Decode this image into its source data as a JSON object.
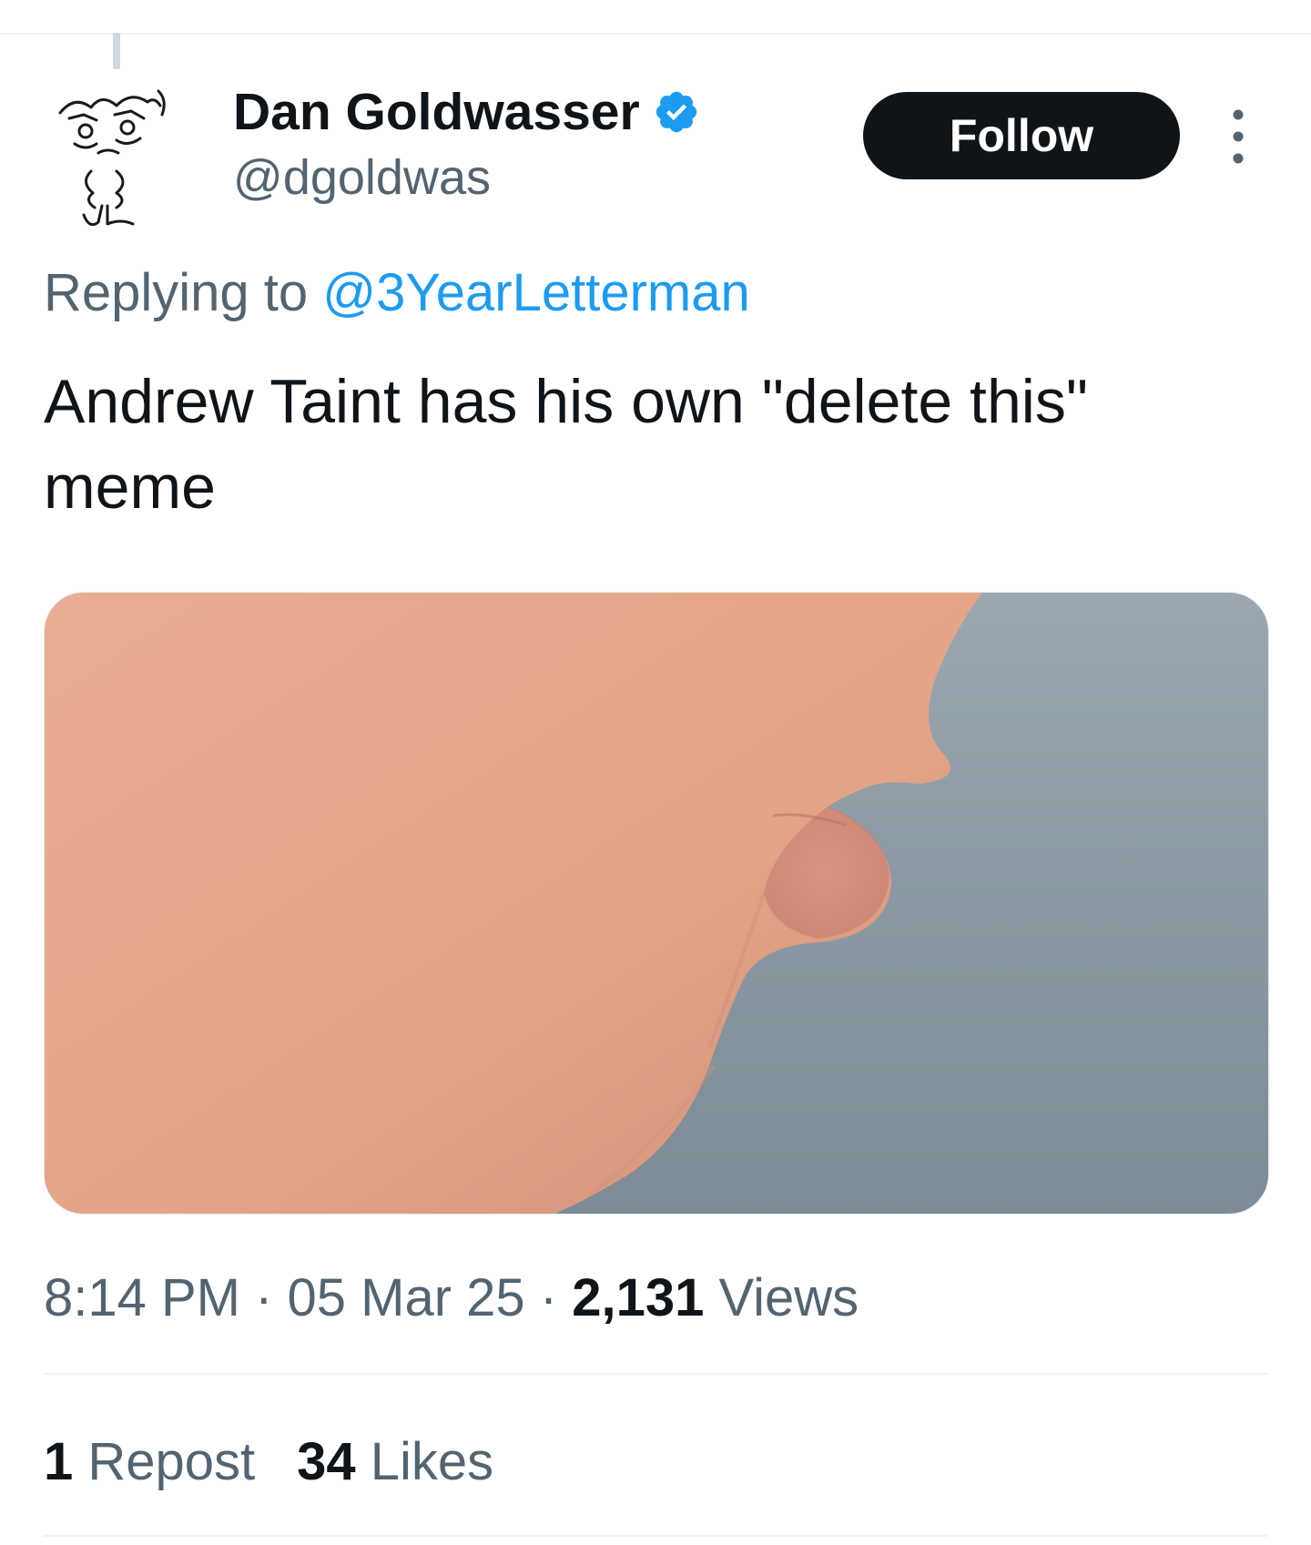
{
  "tweet": {
    "author": {
      "display_name": "Dan Goldwasser",
      "handle": "@dgoldwas",
      "verified": true,
      "avatar_icon": "cartoon-face-avatar"
    },
    "follow_label": "Follow",
    "more_icon": "more-vertical-icon",
    "reply": {
      "prefix": "Replying to ",
      "mention": "@3YearLetterman"
    },
    "text": "Andrew Taint has his own \"delete this\" meme",
    "media": {
      "type": "photo",
      "colors": {
        "skin": "#e7a98e",
        "background": "#8a97a2"
      }
    },
    "meta": {
      "time": "8:14 PM",
      "separator": " · ",
      "date": "05 Mar 25",
      "views_count": "2,131",
      "views_label": " Views"
    },
    "stats": {
      "reposts_count": "1",
      "reposts_label": " Repost",
      "likes_count": "34",
      "likes_label": " Likes"
    }
  },
  "colors": {
    "text_primary": "#0f1419",
    "text_secondary": "#536471",
    "accent": "#1d9bf0",
    "divider": "#eff3f4"
  }
}
